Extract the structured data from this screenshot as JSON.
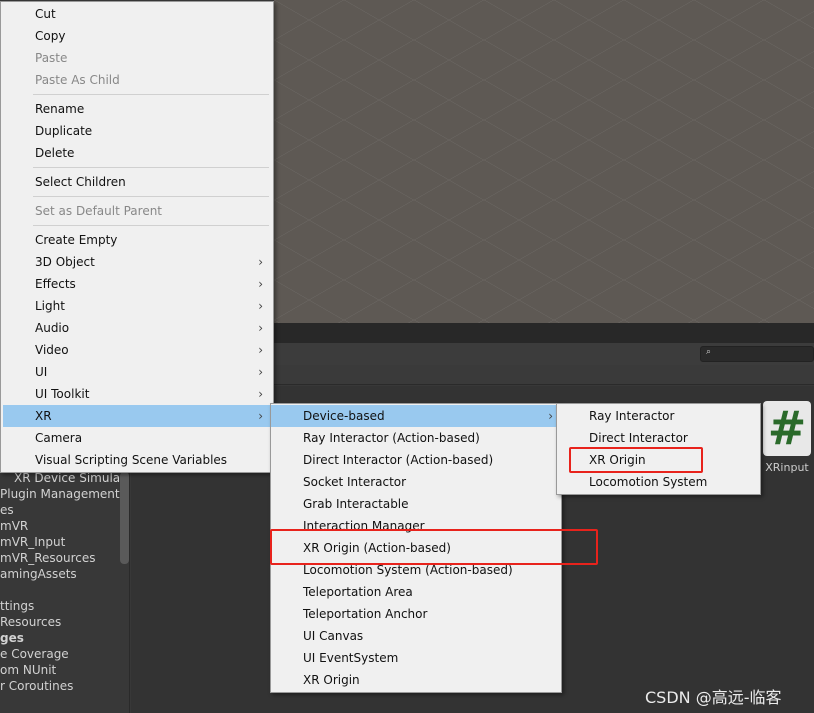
{
  "context_menu": {
    "items": [
      {
        "label": "Cut",
        "disabled": false
      },
      {
        "label": "Copy",
        "disabled": false
      },
      {
        "label": "Paste",
        "disabled": true
      },
      {
        "label": "Paste As Child",
        "disabled": true
      },
      {
        "sep": true
      },
      {
        "label": "Rename"
      },
      {
        "label": "Duplicate"
      },
      {
        "label": "Delete"
      },
      {
        "sep": true
      },
      {
        "label": "Select Children"
      },
      {
        "sep": true
      },
      {
        "label": "Set as Default Parent",
        "disabled": true
      },
      {
        "sep": true
      },
      {
        "label": "Create Empty"
      },
      {
        "label": "3D Object",
        "submenu": true
      },
      {
        "label": "Effects",
        "submenu": true
      },
      {
        "label": "Light",
        "submenu": true
      },
      {
        "label": "Audio",
        "submenu": true
      },
      {
        "label": "Video",
        "submenu": true
      },
      {
        "label": "UI",
        "submenu": true
      },
      {
        "label": "UI Toolkit",
        "submenu": true
      },
      {
        "label": "XR",
        "submenu": true,
        "highlighted": true
      },
      {
        "label": "Camera"
      },
      {
        "label": "Visual Scripting Scene Variables"
      }
    ]
  },
  "xr_submenu": {
    "items": [
      {
        "label": "Device-based",
        "submenu": true,
        "highlighted": true
      },
      {
        "label": "Ray Interactor (Action-based)"
      },
      {
        "label": "Direct Interactor (Action-based)"
      },
      {
        "label": "Socket Interactor"
      },
      {
        "label": "Grab Interactable"
      },
      {
        "label": "Interaction Manager"
      },
      {
        "label": "XR Origin (Action-based)",
        "boxed": true
      },
      {
        "label": "Locomotion System (Action-based)"
      },
      {
        "label": "Teleportation Area"
      },
      {
        "label": "Teleportation Anchor"
      },
      {
        "label": "UI Canvas"
      },
      {
        "label": "UI EventSystem"
      },
      {
        "label": "XR Origin"
      }
    ]
  },
  "device_submenu": {
    "items": [
      {
        "label": "Ray Interactor"
      },
      {
        "label": "Direct Interactor"
      },
      {
        "label": "XR Origin",
        "boxed": true
      },
      {
        "label": "Locomotion System"
      }
    ]
  },
  "project_tree": [
    "XR Device Simulat",
    "Plugin Management",
    "es",
    "mVR",
    "mVR_Input",
    "mVR_Resources",
    "amingAssets",
    "",
    "ttings",
    "Resources",
    "ges",
    "e Coverage",
    "om NUnit",
    "r Coroutines"
  ],
  "asset": {
    "icon": "#",
    "name": "XRinput"
  },
  "search_icon": "⌕",
  "highlight_color": "#99c9ef",
  "box_color": "#e8231c",
  "watermark": "CSDN @高远-临客"
}
